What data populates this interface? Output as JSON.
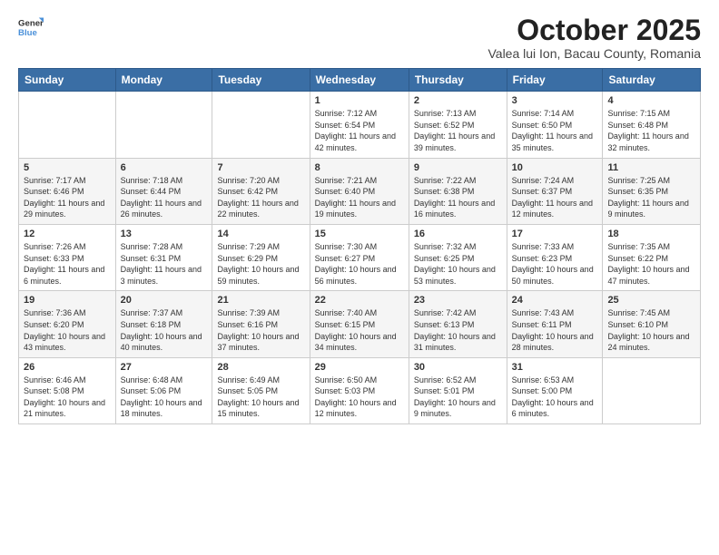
{
  "header": {
    "logo_general": "General",
    "logo_blue": "Blue",
    "main_title": "October 2025",
    "subtitle": "Valea lui Ion, Bacau County, Romania"
  },
  "days_header": [
    "Sunday",
    "Monday",
    "Tuesday",
    "Wednesday",
    "Thursday",
    "Friday",
    "Saturday"
  ],
  "weeks": [
    [
      {
        "day": "",
        "info": ""
      },
      {
        "day": "",
        "info": ""
      },
      {
        "day": "",
        "info": ""
      },
      {
        "day": "1",
        "info": "Sunrise: 7:12 AM\nSunset: 6:54 PM\nDaylight: 11 hours and 42 minutes."
      },
      {
        "day": "2",
        "info": "Sunrise: 7:13 AM\nSunset: 6:52 PM\nDaylight: 11 hours and 39 minutes."
      },
      {
        "day": "3",
        "info": "Sunrise: 7:14 AM\nSunset: 6:50 PM\nDaylight: 11 hours and 35 minutes."
      },
      {
        "day": "4",
        "info": "Sunrise: 7:15 AM\nSunset: 6:48 PM\nDaylight: 11 hours and 32 minutes."
      }
    ],
    [
      {
        "day": "5",
        "info": "Sunrise: 7:17 AM\nSunset: 6:46 PM\nDaylight: 11 hours and 29 minutes."
      },
      {
        "day": "6",
        "info": "Sunrise: 7:18 AM\nSunset: 6:44 PM\nDaylight: 11 hours and 26 minutes."
      },
      {
        "day": "7",
        "info": "Sunrise: 7:20 AM\nSunset: 6:42 PM\nDaylight: 11 hours and 22 minutes."
      },
      {
        "day": "8",
        "info": "Sunrise: 7:21 AM\nSunset: 6:40 PM\nDaylight: 11 hours and 19 minutes."
      },
      {
        "day": "9",
        "info": "Sunrise: 7:22 AM\nSunset: 6:38 PM\nDaylight: 11 hours and 16 minutes."
      },
      {
        "day": "10",
        "info": "Sunrise: 7:24 AM\nSunset: 6:37 PM\nDaylight: 11 hours and 12 minutes."
      },
      {
        "day": "11",
        "info": "Sunrise: 7:25 AM\nSunset: 6:35 PM\nDaylight: 11 hours and 9 minutes."
      }
    ],
    [
      {
        "day": "12",
        "info": "Sunrise: 7:26 AM\nSunset: 6:33 PM\nDaylight: 11 hours and 6 minutes."
      },
      {
        "day": "13",
        "info": "Sunrise: 7:28 AM\nSunset: 6:31 PM\nDaylight: 11 hours and 3 minutes."
      },
      {
        "day": "14",
        "info": "Sunrise: 7:29 AM\nSunset: 6:29 PM\nDaylight: 10 hours and 59 minutes."
      },
      {
        "day": "15",
        "info": "Sunrise: 7:30 AM\nSunset: 6:27 PM\nDaylight: 10 hours and 56 minutes."
      },
      {
        "day": "16",
        "info": "Sunrise: 7:32 AM\nSunset: 6:25 PM\nDaylight: 10 hours and 53 minutes."
      },
      {
        "day": "17",
        "info": "Sunrise: 7:33 AM\nSunset: 6:23 PM\nDaylight: 10 hours and 50 minutes."
      },
      {
        "day": "18",
        "info": "Sunrise: 7:35 AM\nSunset: 6:22 PM\nDaylight: 10 hours and 47 minutes."
      }
    ],
    [
      {
        "day": "19",
        "info": "Sunrise: 7:36 AM\nSunset: 6:20 PM\nDaylight: 10 hours and 43 minutes."
      },
      {
        "day": "20",
        "info": "Sunrise: 7:37 AM\nSunset: 6:18 PM\nDaylight: 10 hours and 40 minutes."
      },
      {
        "day": "21",
        "info": "Sunrise: 7:39 AM\nSunset: 6:16 PM\nDaylight: 10 hours and 37 minutes."
      },
      {
        "day": "22",
        "info": "Sunrise: 7:40 AM\nSunset: 6:15 PM\nDaylight: 10 hours and 34 minutes."
      },
      {
        "day": "23",
        "info": "Sunrise: 7:42 AM\nSunset: 6:13 PM\nDaylight: 10 hours and 31 minutes."
      },
      {
        "day": "24",
        "info": "Sunrise: 7:43 AM\nSunset: 6:11 PM\nDaylight: 10 hours and 28 minutes."
      },
      {
        "day": "25",
        "info": "Sunrise: 7:45 AM\nSunset: 6:10 PM\nDaylight: 10 hours and 24 minutes."
      }
    ],
    [
      {
        "day": "26",
        "info": "Sunrise: 6:46 AM\nSunset: 5:08 PM\nDaylight: 10 hours and 21 minutes."
      },
      {
        "day": "27",
        "info": "Sunrise: 6:48 AM\nSunset: 5:06 PM\nDaylight: 10 hours and 18 minutes."
      },
      {
        "day": "28",
        "info": "Sunrise: 6:49 AM\nSunset: 5:05 PM\nDaylight: 10 hours and 15 minutes."
      },
      {
        "day": "29",
        "info": "Sunrise: 6:50 AM\nSunset: 5:03 PM\nDaylight: 10 hours and 12 minutes."
      },
      {
        "day": "30",
        "info": "Sunrise: 6:52 AM\nSunset: 5:01 PM\nDaylight: 10 hours and 9 minutes."
      },
      {
        "day": "31",
        "info": "Sunrise: 6:53 AM\nSunset: 5:00 PM\nDaylight: 10 hours and 6 minutes."
      },
      {
        "day": "",
        "info": ""
      }
    ]
  ]
}
